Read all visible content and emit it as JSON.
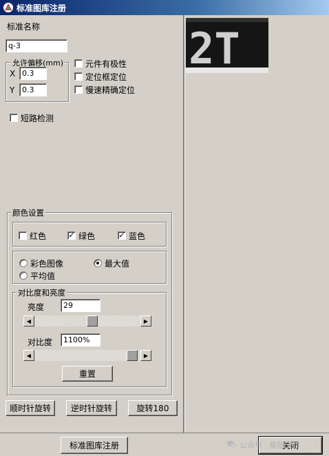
{
  "window": {
    "title": "标准图库注册"
  },
  "left": {
    "name_label": "标准名称",
    "name_value": "q-3",
    "offset_group": "允许偏移(mm)",
    "x_label": "X",
    "x_value": "0.3",
    "y_label": "Y",
    "y_value": "0.3",
    "options": [
      {
        "label": "元件有极性",
        "checked": false
      },
      {
        "label": "定位框定位",
        "checked": false
      },
      {
        "label": "慢速精确定位",
        "checked": false
      }
    ],
    "short_check": {
      "label": "短路检测",
      "checked": false
    }
  },
  "color": {
    "group_label": "颜色设置",
    "channels": [
      {
        "label": "红色",
        "checked": false
      },
      {
        "label": "绿色",
        "checked": true
      },
      {
        "label": "蓝色",
        "checked": true
      }
    ],
    "modes": [
      {
        "label": "彩色图像",
        "selected": false
      },
      {
        "label": "最大值",
        "selected": true
      },
      {
        "label": "平均值",
        "selected": false
      }
    ],
    "contrast_group": "对比度和亮度",
    "brightness_label": "亮度",
    "brightness_value": "29",
    "brightness_level": 0.55,
    "contrast_label": "对比度",
    "contrast_value": "1100%",
    "contrast_level": 0.97,
    "reset_label": "重置"
  },
  "rotate": {
    "cw_label": "顺时针旋转",
    "ccw_label": "逆时针旋转",
    "r180_label": "旋转180"
  },
  "bottom": {
    "register_label": "标准图库注册",
    "close_label": "关闭",
    "watermark": "公众号 · 星阳SMT"
  },
  "preview": {
    "text": "2T"
  }
}
